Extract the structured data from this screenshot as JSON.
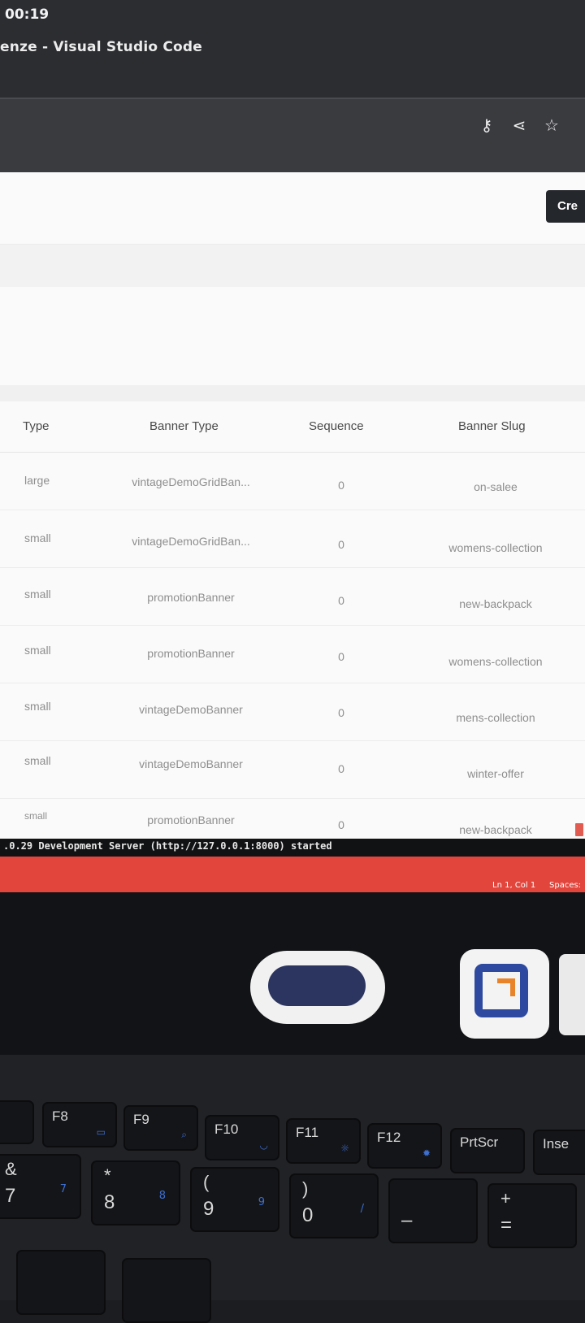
{
  "os": {
    "clock": "00:19"
  },
  "window": {
    "title": "enze - Visual Studio Code"
  },
  "browser": {
    "icons": [
      {
        "name": "key-icon",
        "glyph": "⚷"
      },
      {
        "name": "share-icon",
        "glyph": "⋖"
      },
      {
        "name": "star-icon",
        "glyph": "☆"
      }
    ]
  },
  "page": {
    "create_button_label": "Cre",
    "table": {
      "headers": {
        "type": "Type",
        "banner_type": "Banner Type",
        "sequence": "Sequence",
        "banner_slug": "Banner Slug"
      },
      "rows": [
        {
          "type": "large",
          "banner_type": "vintageDemoGridBan...",
          "sequence": "0",
          "banner_slug": "on-salee"
        },
        {
          "type": "small",
          "banner_type": "vintageDemoGridBan...",
          "sequence": "0",
          "banner_slug": "womens-collection"
        },
        {
          "type": "small",
          "banner_type": "promotionBanner",
          "sequence": "0",
          "banner_slug": "new-backpack"
        },
        {
          "type": "small",
          "banner_type": "promotionBanner",
          "sequence": "0",
          "banner_slug": "womens-collection"
        },
        {
          "type": "small",
          "banner_type": "vintageDemoBanner",
          "sequence": "0",
          "banner_slug": "mens-collection"
        },
        {
          "type": "small",
          "banner_type": "vintageDemoBanner",
          "sequence": "0",
          "banner_slug": "winter-offer"
        },
        {
          "type": "small",
          "banner_type": "promotionBanner",
          "sequence": "0",
          "banner_slug": "new-backpack"
        }
      ]
    }
  },
  "terminal": {
    "text": ".0.29 Development Server (http://127.0.0.1:8000) started"
  },
  "statusbar": {
    "position": "Ln 1, Col 1",
    "spaces": "Spaces:"
  },
  "keyboard": {
    "fkeys": [
      {
        "label": "F8"
      },
      {
        "label": "F9"
      },
      {
        "label": "F10"
      },
      {
        "label": "F11"
      },
      {
        "label": "F12"
      },
      {
        "label": "PrtScr"
      },
      {
        "label": "Inse"
      }
    ],
    "numkeys": [
      {
        "top": "&",
        "big": "7",
        "sub": "7"
      },
      {
        "top": "*",
        "big": "8",
        "sub": "8"
      },
      {
        "top": "(",
        "big": "9",
        "sub": "9"
      },
      {
        "top": ")",
        "big": "0",
        "sub": "/"
      },
      {
        "top": "",
        "big": "–",
        "sub": ""
      },
      {
        "top": "+",
        "big": "=",
        "sub": ""
      }
    ]
  },
  "colors": {
    "statusbar": "#e2453c",
    "create_button": "#24272c",
    "page_bg": "#fafafa"
  }
}
